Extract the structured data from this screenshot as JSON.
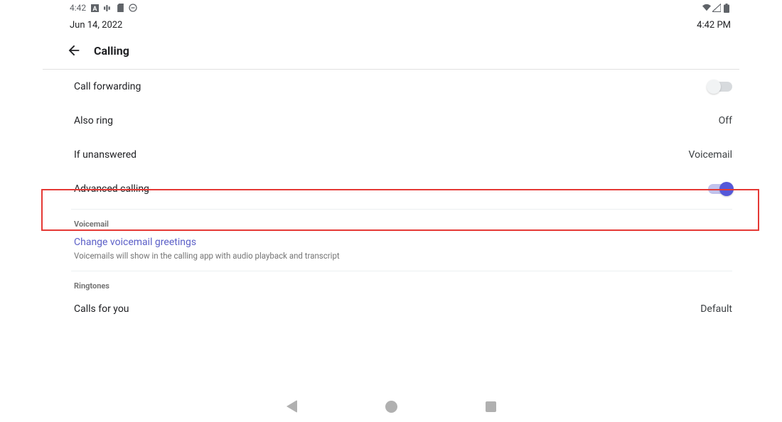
{
  "status_bar": {
    "time_left": "4:42",
    "icons": [
      "app-a-icon",
      "activity-icon",
      "storage-icon",
      "dnd-icon"
    ],
    "right_icons": [
      "wifi-icon",
      "cell-signal-icon",
      "battery-icon"
    ]
  },
  "date_row": {
    "date": "Jun 14, 2022",
    "time": "4:42 PM"
  },
  "header": {
    "title": "Calling"
  },
  "rows": {
    "call_forwarding": {
      "label": "Call forwarding",
      "toggle": "off"
    },
    "also_ring": {
      "label": "Also ring",
      "value": "Off"
    },
    "if_unanswered": {
      "label": "If unanswered",
      "value": "Voicemail"
    },
    "advanced_calling": {
      "label": "Advanced calling",
      "toggle": "on"
    }
  },
  "voicemail_section": {
    "title": "Voicemail",
    "link": "Change voicemail greetings",
    "help": "Voicemails will show in the calling app with audio playback and transcript"
  },
  "ringtones_section": {
    "title": "Ringtones",
    "calls_for_you": {
      "label": "Calls for you",
      "value": "Default"
    }
  }
}
